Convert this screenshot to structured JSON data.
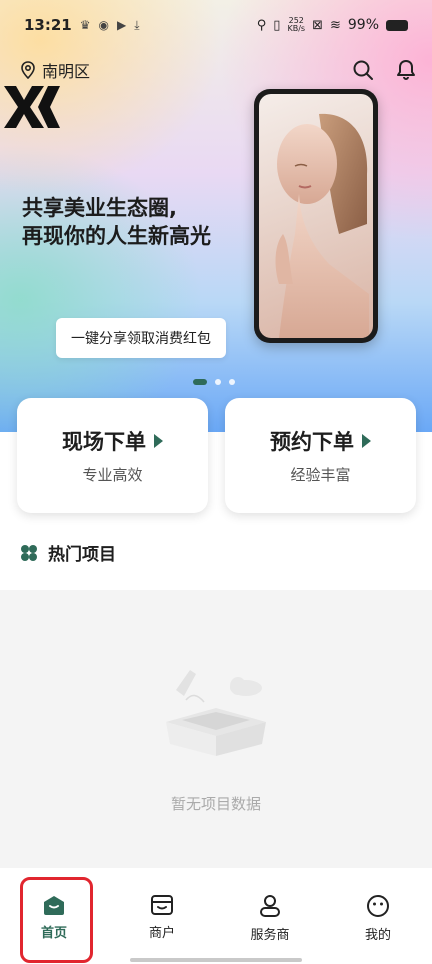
{
  "status_bar": {
    "time": "13:21",
    "net_speed_value": "252",
    "net_speed_unit": "KB/s",
    "battery": "99%"
  },
  "location": {
    "district": "南明区",
    "search_icon": "search-icon",
    "bell_icon": "bell-icon"
  },
  "banner": {
    "slogan_line1": "共享美业生态圈,",
    "slogan_line2": "再现你的人生新高光",
    "share_button": "一键分享领取消费红包",
    "slide_count": 3,
    "active_slide": 1
  },
  "cards": [
    {
      "title": "现场下单",
      "subtitle": "专业高效"
    },
    {
      "title": "预约下单",
      "subtitle": "经验丰富"
    }
  ],
  "section": {
    "title": "热门项目",
    "empty_text": "暂无项目数据"
  },
  "tabbar": {
    "items": [
      {
        "label": "首页",
        "icon": "home-icon",
        "active": true
      },
      {
        "label": "商户",
        "icon": "store-icon",
        "active": false
      },
      {
        "label": "服务商",
        "icon": "person-icon",
        "active": false
      },
      {
        "label": "我的",
        "icon": "smile-icon",
        "active": false
      }
    ]
  },
  "colors": {
    "accent": "#2f6b59",
    "highlight": "#e1262f"
  }
}
